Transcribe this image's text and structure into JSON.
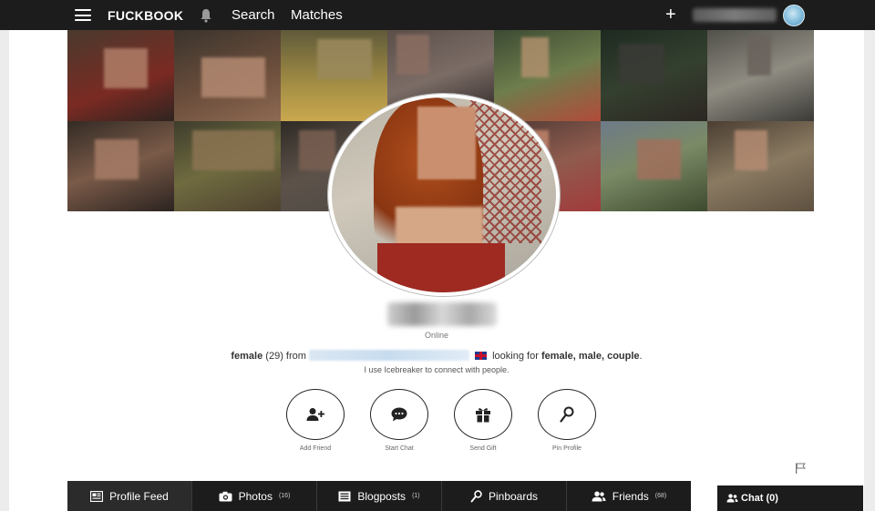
{
  "topbar": {
    "logo": "FUCKBOOK",
    "nav": {
      "search": "Search",
      "matches": "Matches"
    },
    "icons": {
      "menu": "hamburger-menu-icon",
      "notifications": "bell-icon",
      "add": "plus-icon"
    }
  },
  "profile": {
    "status": "Online",
    "gender": "female",
    "age": "(29)",
    "from_label": "from",
    "looking_for_label": "looking for",
    "looking_for": "female, male, couple",
    "period": ".",
    "icebreaker_text": "I use Icebreaker to connect with people."
  },
  "actions": [
    {
      "label": "Add Friend",
      "icon": "add-friend-icon"
    },
    {
      "label": "Start Chat",
      "icon": "chat-bubble-icon"
    },
    {
      "label": "Send Gift",
      "icon": "gift-icon"
    },
    {
      "label": "Pin Profile",
      "icon": "pin-icon"
    }
  ],
  "tabs": [
    {
      "label": "Profile Feed",
      "count": "",
      "icon": "feed-icon"
    },
    {
      "label": "Photos",
      "count": "(16)",
      "icon": "camera-icon"
    },
    {
      "label": "Blogposts",
      "count": "(1)",
      "icon": "blog-icon"
    },
    {
      "label": "Pinboards",
      "count": "",
      "icon": "pin-icon"
    },
    {
      "label": "Friends",
      "count": "(68)",
      "icon": "friends-icon"
    }
  ],
  "chat": {
    "label": "Chat (0)",
    "icon": "people-icon"
  },
  "colors": {
    "topbar_bg": "#1c1c1c",
    "page_bg": "#ececec",
    "card_bg": "#ffffff"
  }
}
